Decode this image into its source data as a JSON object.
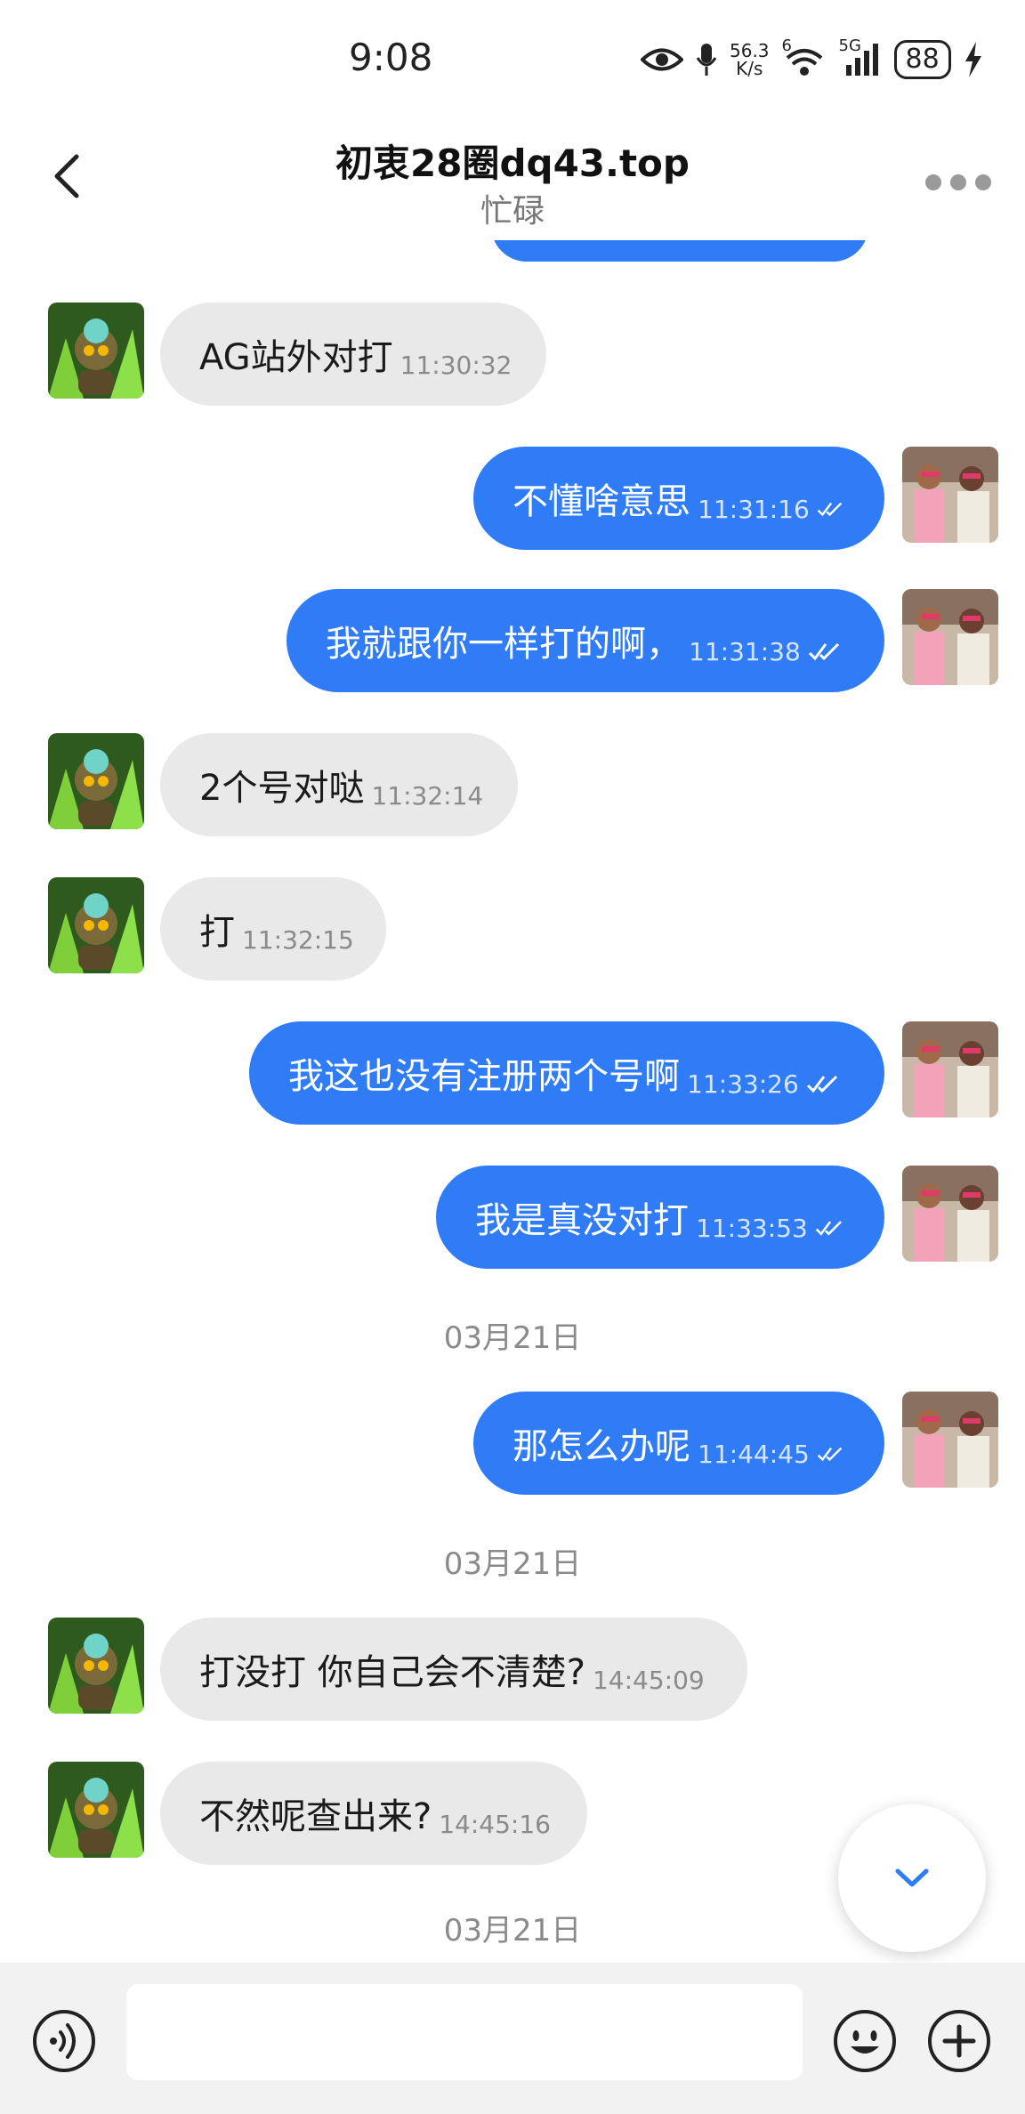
{
  "status_bar": {
    "time": "9:08",
    "net_speed_value": "56.3",
    "net_speed_unit": "K/s",
    "wifi_label": "6",
    "cellular_label": "5G",
    "battery": "88"
  },
  "header": {
    "title": "初衷28圈dq43.top",
    "subtitle": "忙碌"
  },
  "messages": [
    {
      "side": "in",
      "text": "AG站外对打",
      "time": "11:30:32"
    },
    {
      "side": "out",
      "text": "不懂啥意思",
      "time": "11:31:16",
      "read": true
    },
    {
      "side": "out",
      "text": "我就跟你一样打的啊，",
      "time": "11:31:38",
      "read": true
    },
    {
      "side": "in",
      "text": "2个号对哒",
      "time": "11:32:14"
    },
    {
      "side": "in",
      "text": "打",
      "time": "11:32:15"
    },
    {
      "side": "out",
      "text": "我这也没有注册两个号啊",
      "time": "11:33:26",
      "read": true
    },
    {
      "side": "out",
      "text": "我是真没对打",
      "time": "11:33:53",
      "read": true
    },
    {
      "side": "out",
      "text": "那怎么办呢",
      "time": "11:44:45",
      "read": true
    },
    {
      "side": "in",
      "text": "打没打 你自己会不清楚?",
      "time": "14:45:09"
    },
    {
      "side": "in",
      "text": "不然呢查出来?",
      "time": "14:45:16"
    }
  ],
  "date_separators": [
    "03月21日",
    "03月21日",
    "03月21日"
  ],
  "input": {
    "placeholder": ""
  },
  "colors": {
    "outgoing_bubble": "#2f7cf6",
    "incoming_bubble": "#e9e9e9",
    "accent": "#2f7cf6"
  }
}
